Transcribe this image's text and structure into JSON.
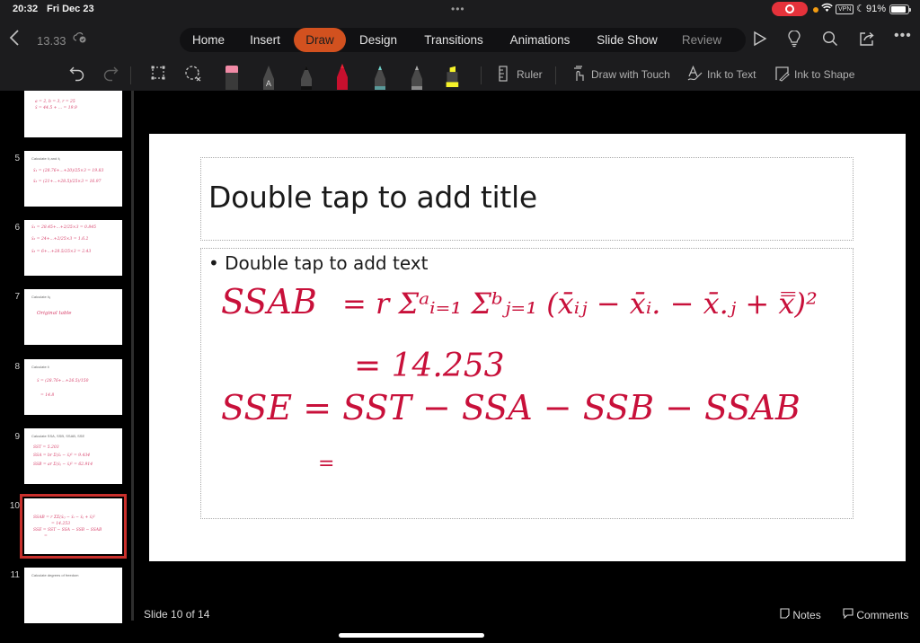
{
  "status_bar": {
    "time": "20:32",
    "date": "Fri Dec 23",
    "multitask": "•••",
    "vpn": "VPN",
    "battery": "91%",
    "battery_level": 0.91,
    "icons": [
      "screen-recording-icon",
      "camera-indicator-icon",
      "wifi-icon",
      "vpn-icon",
      "do-not-disturb-icon",
      "battery-icon"
    ]
  },
  "header": {
    "back_icon": "‹",
    "document_name": "13.33",
    "cloud_icon": "cloud-sync-icon",
    "tabs": [
      {
        "label": "Home",
        "active": false
      },
      {
        "label": "Insert",
        "active": false
      },
      {
        "label": "Draw",
        "active": true
      },
      {
        "label": "Design",
        "active": false
      },
      {
        "label": "Transitions",
        "active": false
      },
      {
        "label": "Animations",
        "active": false
      },
      {
        "label": "Slide Show",
        "active": false
      },
      {
        "label": "Review",
        "active": false
      }
    ],
    "actions": [
      "play-icon",
      "lightbulb-icon",
      "search-icon",
      "share-icon",
      "more-icon"
    ]
  },
  "draw_toolbar": {
    "undo": "undo-icon",
    "redo": "redo-icon",
    "select": "lasso-select-icon",
    "lasso": "ink-lasso-icon",
    "pens": [
      {
        "name": "eraser",
        "color": "#f18aa6"
      },
      {
        "name": "text-pen",
        "color": "#8a8a8a",
        "label": "A"
      },
      {
        "name": "black-pen",
        "color": "#111111"
      },
      {
        "name": "red-pen",
        "color": "#d0103a"
      },
      {
        "name": "teal-pen",
        "color": "#6fd0c8"
      },
      {
        "name": "gray-pencil",
        "color": "#9a9a9a"
      },
      {
        "name": "yellow-highlighter",
        "color": "#f5f22a"
      }
    ],
    "ruler_label": "Ruler",
    "draw_touch_label": "Draw with Touch",
    "ink_text_label": "Ink to Text",
    "ink_shape_label": "Ink to Shape"
  },
  "sidebar": {
    "slides": [
      {
        "number": "",
        "title": "",
        "ink": [
          "a = 2, b = 3, r = 25",
          "x̄ = 44.5 + ... = 19.9"
        ]
      },
      {
        "number": "5",
        "title": "Calculate x̄ᵢ and x̄ⱼ",
        "ink": [
          "x̄₁ = (28.76+...+20)/25×3 = 19.83",
          "x̄₂ = (21+...+28.5)/25×3 = 16.97"
        ]
      },
      {
        "number": "6",
        "title": "",
        "ink": [
          "x̄₁ = 28.45+...+2/25×3 = 0.845",
          "x̄₂ = 24+...+2/25×3 = 1.6.2",
          "x̄₃ = 6+...+28.5/25×3 = 2.43"
        ]
      },
      {
        "number": "7",
        "title": "Calculate x̄ᵢⱼ",
        "ink": [
          "Original table"
        ]
      },
      {
        "number": "8",
        "title": "Calculate x̄",
        "ink": [
          "x̄ = (28.76+...+26.5)/150",
          "= 14.8"
        ]
      },
      {
        "number": "9",
        "title": "Calculate SSA, SSB, SSAB, SSE",
        "ink": [
          "SST = 5.203",
          "SSA = br Σ(x̄ᵢ − x̄)² = 9.434",
          "SSB = ar Σ(x̄ⱼ − x̄)² = 62.914"
        ]
      },
      {
        "number": "10",
        "title": "",
        "selected": true,
        "ink": [
          "SSAB = r ΣΣ(x̄ᵢⱼ − x̄ᵢ − x̄ⱼ + x̄)²",
          "= 14.253",
          "SSE = SST − SSA − SSB − SSAB",
          "="
        ]
      },
      {
        "number": "11",
        "title": "Calculate degrees of freedom",
        "ink": []
      }
    ]
  },
  "slide": {
    "title_placeholder": "Double tap to add title",
    "body_placeholder": "Double tap to add text",
    "ink_color": "#c8103a",
    "ink": {
      "line1_lhs": "SSAB",
      "line1_rhs": "= r Σᵃᵢ₌₁ Σᵇⱼ₌₁ (x̄ᵢⱼ − x̄ᵢ. − x̄.ⱼ + x̿)²",
      "line2": "= 14.253",
      "line3": "SSE = SST − SSA − SSB − SSAB",
      "line4": "="
    }
  },
  "footer": {
    "slide_counter": "Slide 10 of 14",
    "notes_label": "Notes",
    "comments_label": "Comments"
  }
}
